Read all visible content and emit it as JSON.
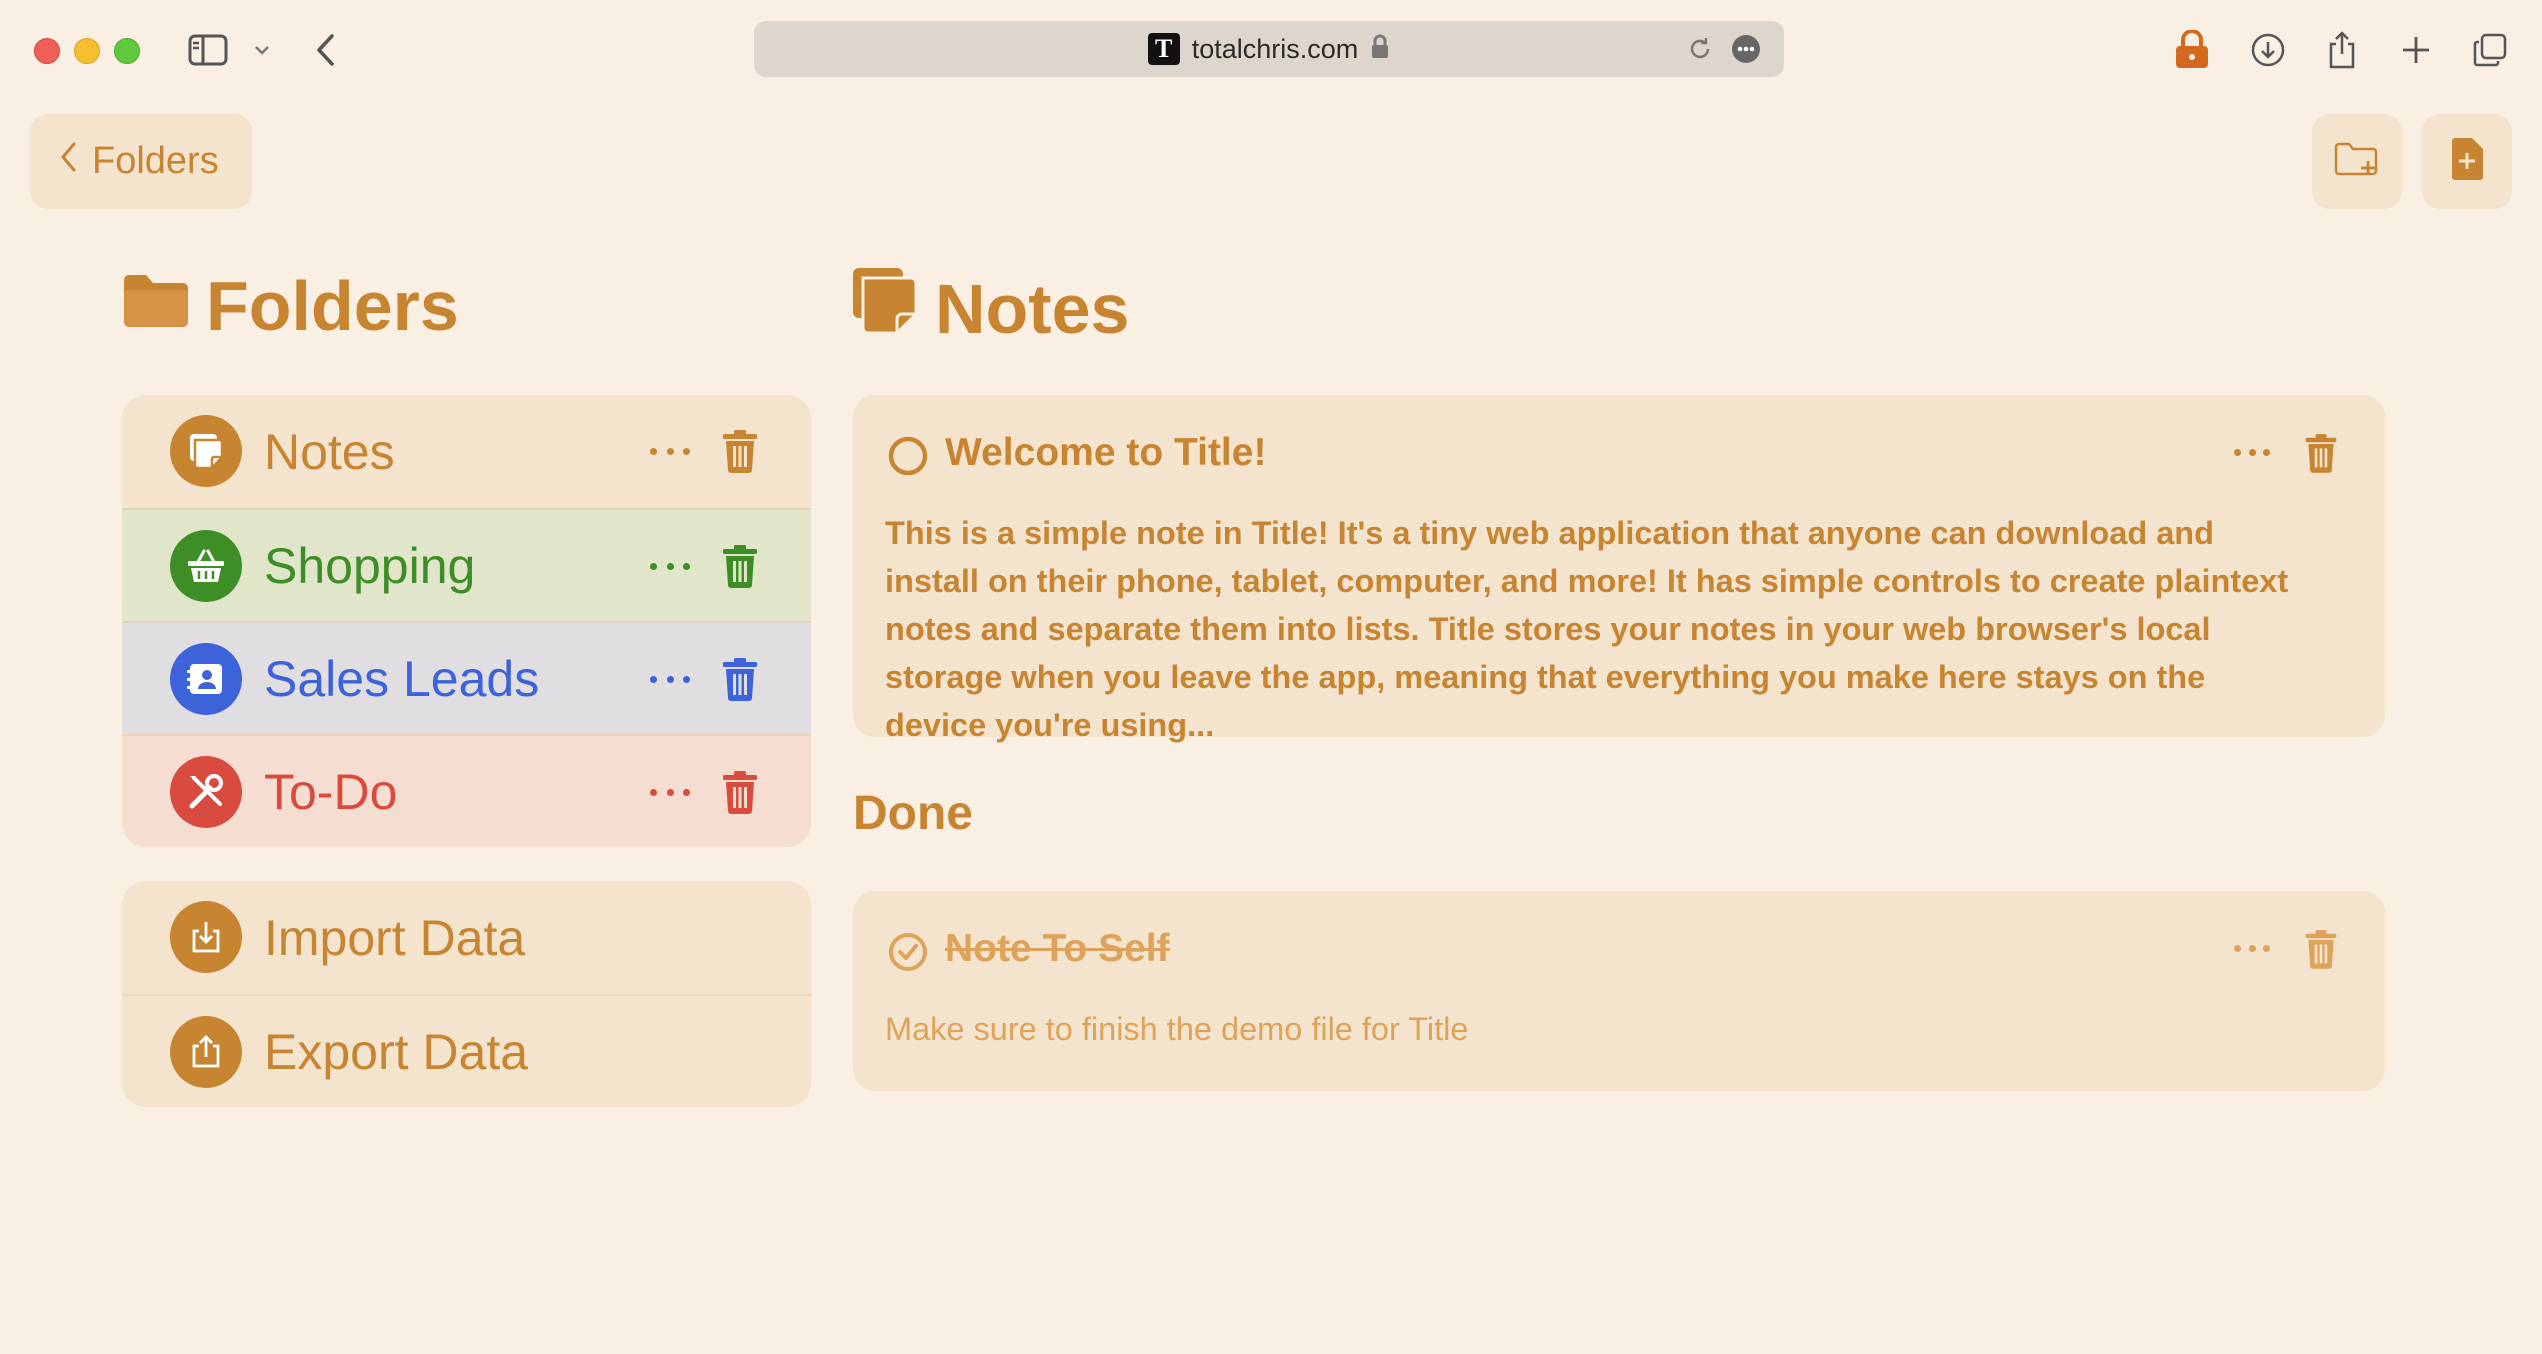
{
  "browser": {
    "url": "totalchris.com",
    "favicon_letter": "T"
  },
  "topbar": {
    "back_label": "Folders"
  },
  "folders": {
    "heading": "Folders",
    "items": [
      {
        "label": "Notes",
        "icon": "note-icon",
        "color": "#C78532",
        "bg": "#F4E3CD"
      },
      {
        "label": "Shopping",
        "icon": "basket-icon",
        "color": "#3E8E27",
        "bg": "#E1E5CA"
      },
      {
        "label": "Sales Leads",
        "icon": "contact-card-icon",
        "color": "#3D63DB",
        "bg": "#E1DEE1"
      },
      {
        "label": "To-Do",
        "icon": "tools-icon",
        "color": "#D94B3F",
        "bg": "#F5DDD1"
      }
    ],
    "data_actions": [
      {
        "label": "Import Data",
        "icon": "import-icon"
      },
      {
        "label": "Export Data",
        "icon": "export-icon"
      }
    ]
  },
  "notes": {
    "heading": "Notes",
    "active": [
      {
        "title": "Welcome to Title!",
        "body": "This is a simple note in Title! It's a tiny web application that anyone can download and install on their phone, tablet, computer, and more! It has simple controls to create plaintext notes and separate them into lists. Title stores your notes in your web browser's local storage when you leave the app, meaning that everything you make here stays on the device you're using..."
      }
    ],
    "done_heading": "Done",
    "done": [
      {
        "title": "Note To Self",
        "body": "Make sure to finish the demo file for Title"
      }
    ]
  },
  "colors": {
    "accent": "#C78532",
    "background": "#F9EFE2",
    "card": "#F4E3CD",
    "lock": "#D2691E"
  }
}
